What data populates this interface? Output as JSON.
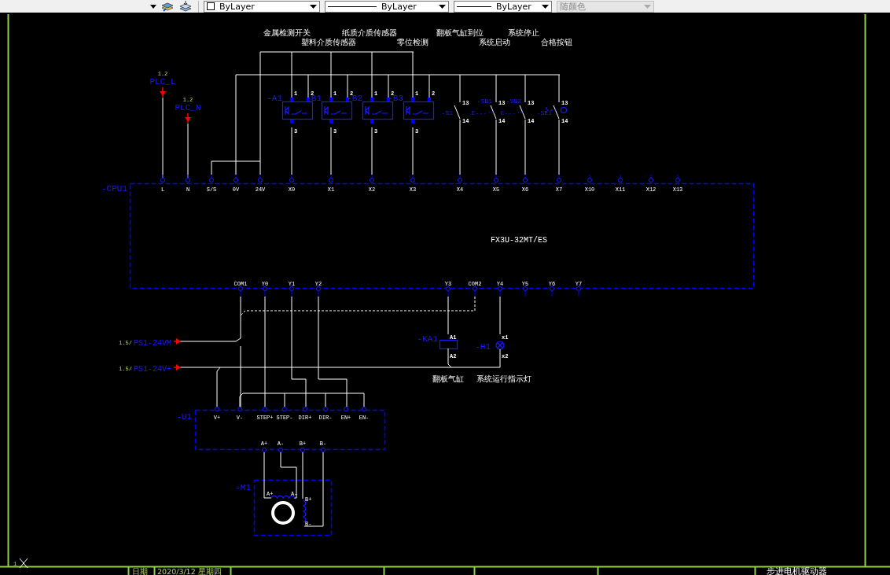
{
  "toolbar": {
    "combos": [
      {
        "kind": "color",
        "value": "ByLayer",
        "disabled": false
      },
      {
        "kind": "linetype",
        "value": "ByLayer",
        "disabled": false
      },
      {
        "kind": "lineweight",
        "value": "ByLayer",
        "disabled": false
      },
      {
        "kind": "plotstyle",
        "value": "随颜色",
        "disabled": true
      }
    ]
  },
  "drawing": {
    "signal_labels": [
      "金属检测开关",
      "塑料介质传感器",
      "纸质介质传感器",
      "零位检测",
      "翻板气缸到位",
      "系统启动",
      "系统停止",
      "合格按钮"
    ],
    "power_inputs": [
      {
        "ref": "1.2",
        "name": "PLC_L"
      },
      {
        "ref": "1.2",
        "name": "PLC_N"
      }
    ],
    "plc": {
      "tag": "-CPU1",
      "model": "FX3U-32MT/ES",
      "inputs": [
        "L",
        "N",
        "S/S",
        "0V",
        "24V",
        "X0",
        "X1",
        "X2",
        "X3",
        "X4",
        "X5",
        "X6",
        "X7",
        "X10",
        "X11",
        "X12",
        "X13"
      ],
      "outputs": [
        "COM1",
        "Y0",
        "Y1",
        "Y2",
        "Y3",
        "COM2",
        "Y4",
        "Y5",
        "Y6",
        "Y7"
      ]
    },
    "sensors": [
      {
        "tag": "-A1",
        "pins": [
          "1",
          "2",
          "3"
        ]
      },
      {
        "tag": "-B1",
        "pins": [
          "1",
          "2",
          "3"
        ]
      },
      {
        "tag": "-B2",
        "pins": [
          "1",
          "2",
          "3"
        ]
      },
      {
        "tag": "-B3",
        "pins": [
          "1",
          "2",
          "3"
        ]
      }
    ],
    "switches": [
      {
        "tag": "-S1",
        "kind": "toggle",
        "pins": [
          "13",
          "14"
        ]
      },
      {
        "tag": "-SB1",
        "kind": "pushbutton",
        "actuator": "E---",
        "pins": [
          "13",
          "14"
        ]
      },
      {
        "tag": "-SB2",
        "kind": "pushbutton",
        "actuator": "E---",
        "pins": [
          "13",
          "14"
        ]
      },
      {
        "tag": "-SE1",
        "kind": "illuminated",
        "pins": [
          "13",
          "14"
        ]
      }
    ],
    "supplies": [
      {
        "ref": "1.5/",
        "name": "PS1-24VM"
      },
      {
        "ref": "1.5/",
        "name": "PS1-24V+"
      }
    ],
    "relay": {
      "tag": "-KA1",
      "pins": [
        "A1",
        "A2"
      ],
      "caption": "翻板气缸"
    },
    "lamp": {
      "tag": "-H1",
      "pins": [
        "x1",
        "x2"
      ],
      "caption": "系统运行指示灯"
    },
    "driver": {
      "tag": "-U1",
      "inputs": [
        "V+",
        "V-",
        "STEP+",
        "STEP-",
        "DIR+",
        "DIR-",
        "EN+",
        "EN-"
      ],
      "outputs": [
        "A+",
        "A-",
        "B+",
        "B-"
      ]
    },
    "motor": {
      "tag": "-M1",
      "coil_a": [
        "A+",
        "A-"
      ],
      "coil_b": [
        "B+",
        "B-"
      ]
    }
  },
  "command_line": {
    "prompt": "1"
  },
  "title_block": {
    "date_label": "日期",
    "date": "2020/3/12 星期四",
    "title": "步进电机驱动器"
  }
}
